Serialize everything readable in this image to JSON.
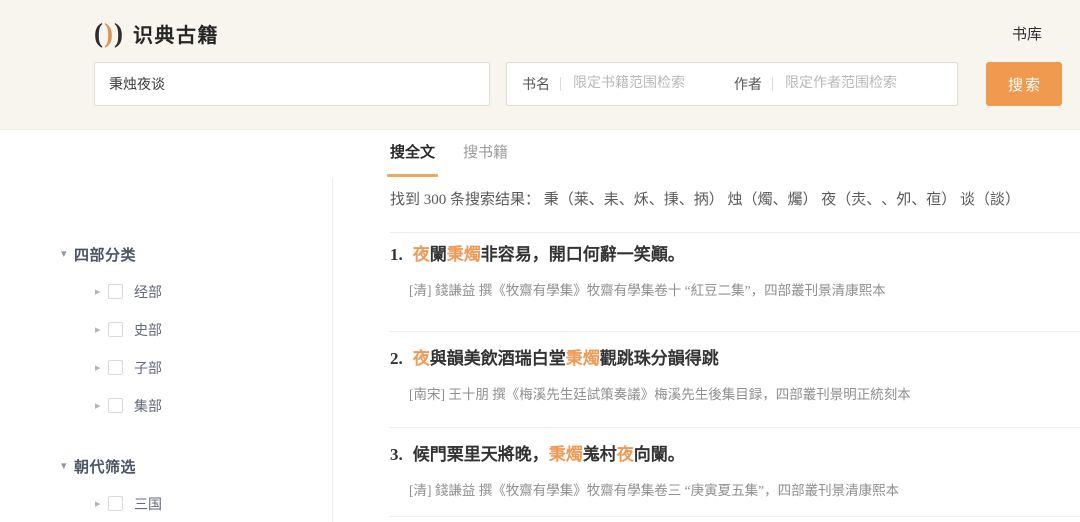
{
  "header": {
    "brackets": [
      "(",
      ")",
      ")"
    ],
    "title": "识典古籍",
    "library_link": "书库"
  },
  "search": {
    "query": "秉烛夜谈",
    "book": {
      "label": "书名",
      "placeholder": "限定书籍范围检索"
    },
    "author": {
      "label": "作者",
      "placeholder": "限定作者范围检索"
    },
    "button_label": "搜索"
  },
  "tabs": [
    {
      "name": "tab-search-fulltext",
      "label": "搜全文",
      "active": true
    },
    {
      "name": "tab-search-books",
      "label": "搜书籍",
      "active": false
    }
  ],
  "sidebar": {
    "sections": [
      {
        "title": "四部分类",
        "items": [
          "经部",
          "史部",
          "子部",
          "集部"
        ]
      },
      {
        "title": "朝代筛选",
        "items": [
          "三国"
        ]
      }
    ]
  },
  "results": {
    "summary": "找到 300 条搜索结果： 秉（莱、耒、秌、㨀、抦） 烛（燭、爥） 夜（灻、𠛛、夘、亱） 谈（談）",
    "items": [
      {
        "num": "1.",
        "segments": [
          {
            "text": "夜",
            "hl": true
          },
          {
            "text": "闌",
            "hl": false
          },
          {
            "text": "秉燭",
            "hl": true
          },
          {
            "text": "非容易，開口何辭一笑顚。",
            "hl": false
          }
        ],
        "citation": "[清] 錢謙益 撰《牧齋有學集》牧齋有學集卷十 “紅豆二集”，四部叢刊景清康熙本"
      },
      {
        "num": "2.",
        "segments": [
          {
            "text": "夜",
            "hl": true
          },
          {
            "text": "與韻美飲酒瑞白堂",
            "hl": false
          },
          {
            "text": "秉燭",
            "hl": true
          },
          {
            "text": "觀跳珠分韻得跳",
            "hl": false
          }
        ],
        "citation": "[南宋] 王十朋 撰《梅溪先生廷試策奏議》梅溪先生後集目録，四部叢刊景明正統刻本"
      },
      {
        "num": "3.",
        "segments": [
          {
            "text": "候門栗里天將晚，",
            "hl": false
          },
          {
            "text": "秉燭",
            "hl": true
          },
          {
            "text": "羗村",
            "hl": false
          },
          {
            "text": "夜",
            "hl": true
          },
          {
            "text": "向闌。",
            "hl": false
          }
        ],
        "citation": "[清] 錢謙益 撰《牧齋有學集》牧齋有學集卷三 “庚寅夏五集”，四部叢刊景清康熙本"
      }
    ]
  },
  "icons": {
    "caret_down": "▾",
    "caret_right": "▸"
  },
  "colors": {
    "accent": "#EF9A4F",
    "highlight": "#ED9A57",
    "header_bg": "#F8F5EE"
  }
}
